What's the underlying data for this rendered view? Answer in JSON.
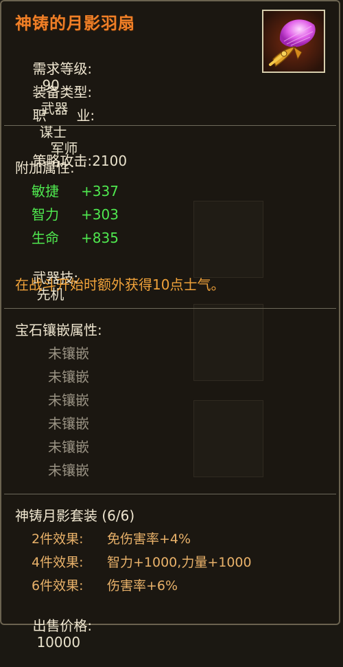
{
  "item": {
    "name": "神铸的月影羽扇",
    "level_label": "需求等级:",
    "level_value": "90",
    "type_label": "装备类型:",
    "type_value": "武器",
    "class_label_1": "职",
    "class_label_2": "业:",
    "class_value_1": "谋士",
    "class_value_2": "军师"
  },
  "stats": {
    "attack_label": "策略攻击:",
    "attack_value": "2100",
    "extra_label": "附加属性:",
    "extras": [
      {
        "name": "敏捷",
        "value": "+337"
      },
      {
        "name": "智力",
        "value": "+303"
      },
      {
        "name": "生命",
        "value": "+835"
      }
    ],
    "skill_label": "武器技:",
    "skill_value": "先机",
    "skill_desc": "在战斗开始时额外获得10点士气。"
  },
  "gems": {
    "label": "宝石镶嵌属性:",
    "slots": [
      "未镶嵌",
      "未镶嵌",
      "未镶嵌",
      "未镶嵌",
      "未镶嵌",
      "未镶嵌"
    ]
  },
  "set": {
    "name": "神铸月影套装 (6/6)",
    "bonuses": [
      {
        "label": "2件效果:",
        "value": "免伤害率+4%"
      },
      {
        "label": "4件效果:",
        "value": "智力+1000,力量+1000"
      },
      {
        "label": "6件效果:",
        "value": "伤害率+6%"
      }
    ]
  },
  "price": {
    "label": "出售价格:",
    "value": "10000"
  },
  "colors": {
    "title": "#f07f27",
    "green_stat": "#4fe84f",
    "skill_desc": "#f0a23a",
    "empty_gem": "#9a9384",
    "set_bonus": "#e9b26a"
  },
  "icon": "feather-fan-icon"
}
